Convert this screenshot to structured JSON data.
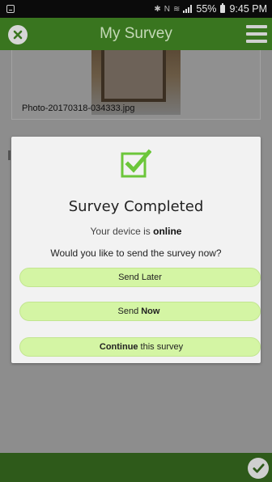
{
  "status_bar": {
    "battery": "55%",
    "time": "9:45 PM"
  },
  "header": {
    "title": "My Survey"
  },
  "background": {
    "photo_caption": "Photo-20170318-034333.jpg"
  },
  "dialog": {
    "title": "Survey Completed",
    "status_prefix": "Your device is",
    "status_value": "online",
    "question": "Would you like to send the survey now?",
    "send_later": "Send Later",
    "send_now_prefix": "Send",
    "send_now_bold": "Now",
    "continue_bold": "Continue",
    "continue_suffix": "this survey"
  },
  "colors": {
    "accent": "#39751f",
    "button_fill": "#d4f5a4",
    "check_icon": "#6cc63a"
  }
}
